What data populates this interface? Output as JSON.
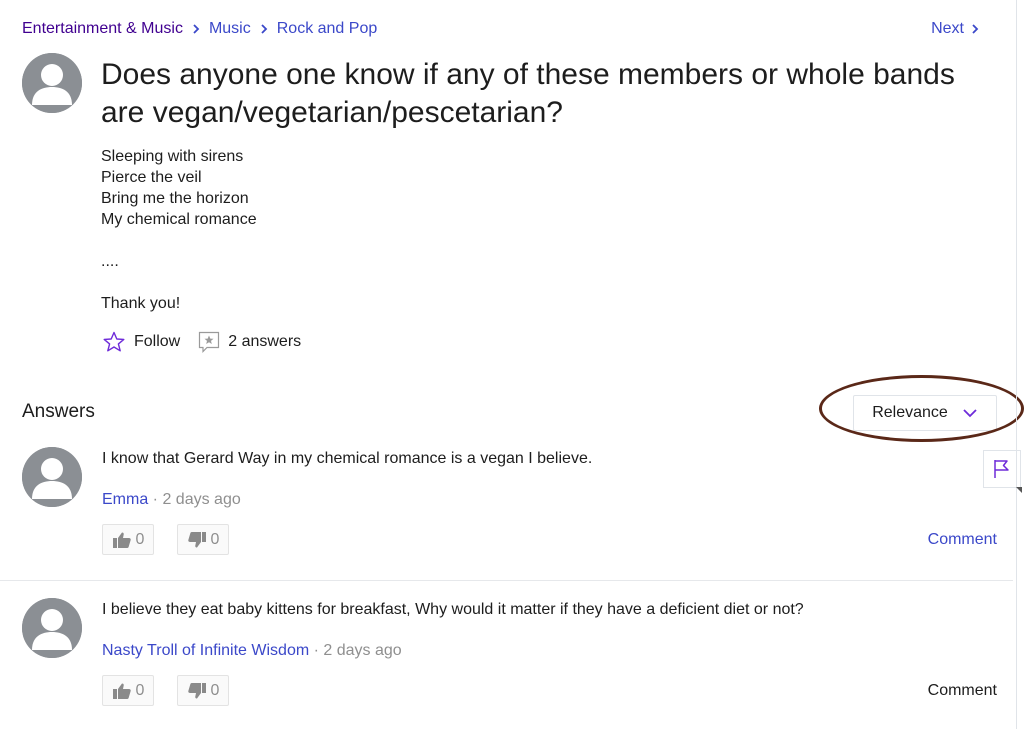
{
  "breadcrumb": {
    "items": [
      "Entertainment & Music",
      "Music",
      "Rock and Pop"
    ],
    "next_label": "Next"
  },
  "question": {
    "title": "Does anyone one know if any of these members or whole bands are vegan/vegetarian/pescetarian?",
    "body_lines": [
      "Sleeping with sirens",
      "Pierce the veil",
      "Bring me the horizon",
      "My chemical romance",
      "",
      "....",
      "",
      "Thank you!"
    ],
    "follow_label": "Follow",
    "answers_count_label": "2 answers"
  },
  "answers_section": {
    "title": "Answers",
    "sort_label": "Relevance"
  },
  "answers": [
    {
      "text": "I know that Gerard Way in my chemical romance is a vegan I believe.",
      "author": "Emma",
      "time": " · 2 days ago",
      "upvotes": "0",
      "downvotes": "0",
      "comment_label": "Comment",
      "comment_color": "#3b48c9"
    },
    {
      "text": "I believe they eat baby kittens for breakfast, Why would it matter if they have a deficient diet or not?",
      "author": "Nasty Troll of Infinite Wisdom",
      "time": " · 2 days ago",
      "upvotes": "0",
      "downvotes": "0",
      "comment_label": "Comment",
      "comment_color": "#1d1d1d"
    }
  ],
  "colors": {
    "breadcrumb_root": "#400090",
    "link_blue": "#3b48c9",
    "annotation_circle": "#5a2818",
    "accent_purple": "#6e2bd9"
  },
  "icons": [
    "chevron-right-icon",
    "star-outline-icon",
    "answer-bubble-icon",
    "chevron-down-icon",
    "flag-icon",
    "thumbs-up-icon",
    "thumbs-down-icon",
    "user-avatar-icon"
  ]
}
